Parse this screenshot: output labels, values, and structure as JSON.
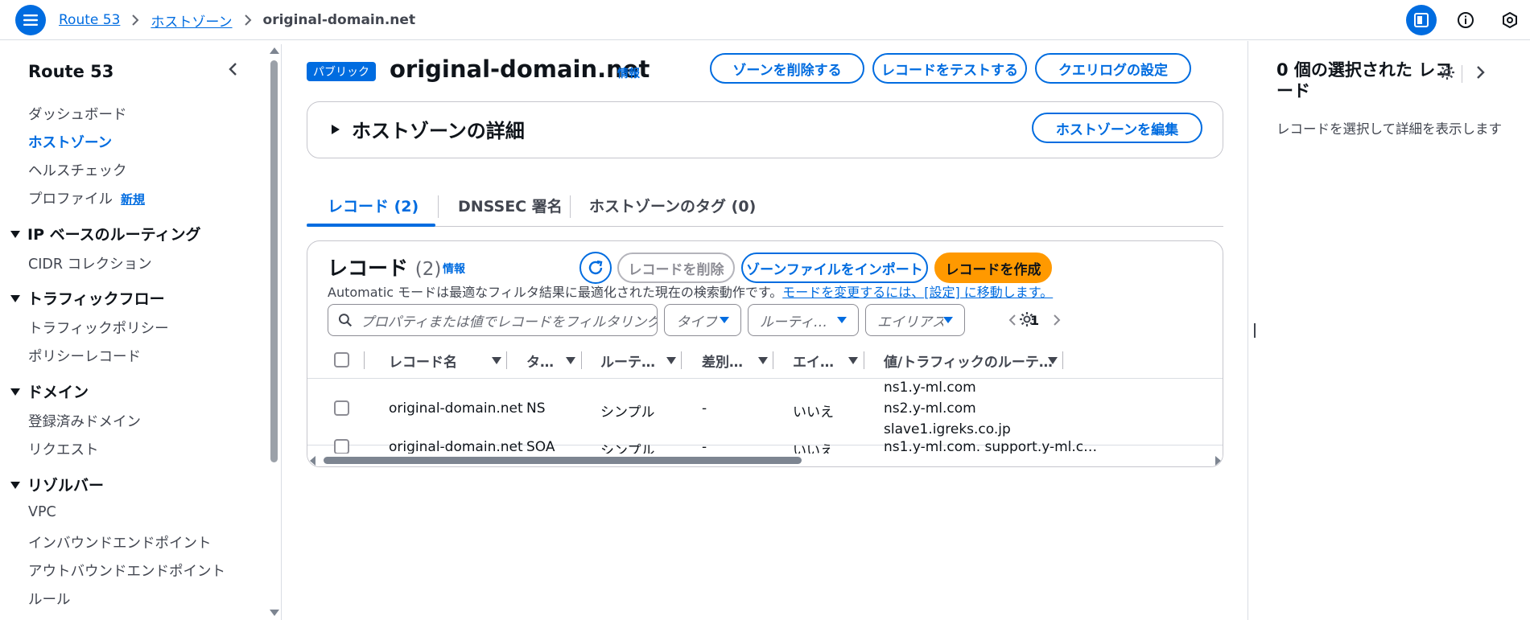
{
  "breadcrumb": {
    "items": [
      "Route 53",
      "ホストゾーン"
    ],
    "current": "original-domain.net"
  },
  "leftnav": {
    "title": "Route 53",
    "items": [
      "ダッシュボード",
      "ホストゾーン",
      "ヘルスチェック",
      "プロファイル"
    ],
    "new_badge": "新規",
    "sections": [
      {
        "title": "IP ベースのルーティング",
        "items": [
          "CIDR コレクション"
        ]
      },
      {
        "title": "トラフィックフロー",
        "items": [
          "トラフィックポリシー",
          "ポリシーレコード"
        ]
      },
      {
        "title": "ドメイン",
        "items": [
          "登録済みドメイン",
          "リクエスト"
        ]
      },
      {
        "title": "リゾルバー",
        "items": [
          "VPC",
          "インバウンドエンドポイント",
          "アウトバウンドエンドポイント",
          "ルール"
        ]
      }
    ]
  },
  "zone": {
    "badge": "パブリック",
    "name": "original-domain.net",
    "info": "情報",
    "actions": [
      "ゾーンを削除する",
      "レコードをテストする",
      "クエリログの設定"
    ]
  },
  "details": {
    "title": "ホストゾーンの詳細",
    "edit_button": "ホストゾーンを編集"
  },
  "tabs": [
    "レコード (2)",
    "DNSSEC 署名",
    "ホストゾーンのタグ (0)"
  ],
  "records": {
    "title": "レコード",
    "count": "(2)",
    "info": "情報",
    "delete_button": "レコードを削除",
    "import_button": "ゾーンファイルをインポート",
    "create_button": "レコードを作成",
    "note": "Automatic モードは最適なフィルタ結果に最適化された現在の検索動作です。",
    "note_link": "モードを変更するには、[設定] に移動します。",
    "search_placeholder": "プロパティまたは値でレコードをフィルタリング",
    "filters": [
      "タイプ",
      "ルーティ…",
      "エイリアス"
    ],
    "page": "1",
    "columns": [
      "レコード名",
      "タ…",
      "ルーテ…",
      "差別…",
      "エイ…",
      "値/トラフィックのルーテ…"
    ],
    "rows": [
      {
        "name": "original-domain.net",
        "type": "NS",
        "routing": "シンプル",
        "diff": "-",
        "alias": "いいえ",
        "values": [
          "ns1.y-ml.com",
          "ns2.y-ml.com",
          "slave1.igreks.co.jp"
        ]
      },
      {
        "name": "original-domain.net",
        "type": "SOA",
        "routing": "シンプル",
        "diff": "-",
        "alias": "いいえ",
        "values": [
          "ns1.y-ml.com. support.y-ml.c…"
        ]
      }
    ]
  },
  "rightpanel": {
    "title": "0 個の選択された レコード",
    "text": "レコードを選択して詳細を表示します"
  },
  "colors": {
    "accent": "#006ce0",
    "primary_button": "#ff9900",
    "border": "#c6c6cd"
  },
  "icons": [
    "menu-icon",
    "chevron-right-icon",
    "panel-icon",
    "info-icon",
    "notifications-icon",
    "chevron-left-icon",
    "caret-down-icon",
    "caret-right-icon",
    "refresh-icon",
    "search-icon",
    "gear-icon",
    "sort-icon"
  ]
}
